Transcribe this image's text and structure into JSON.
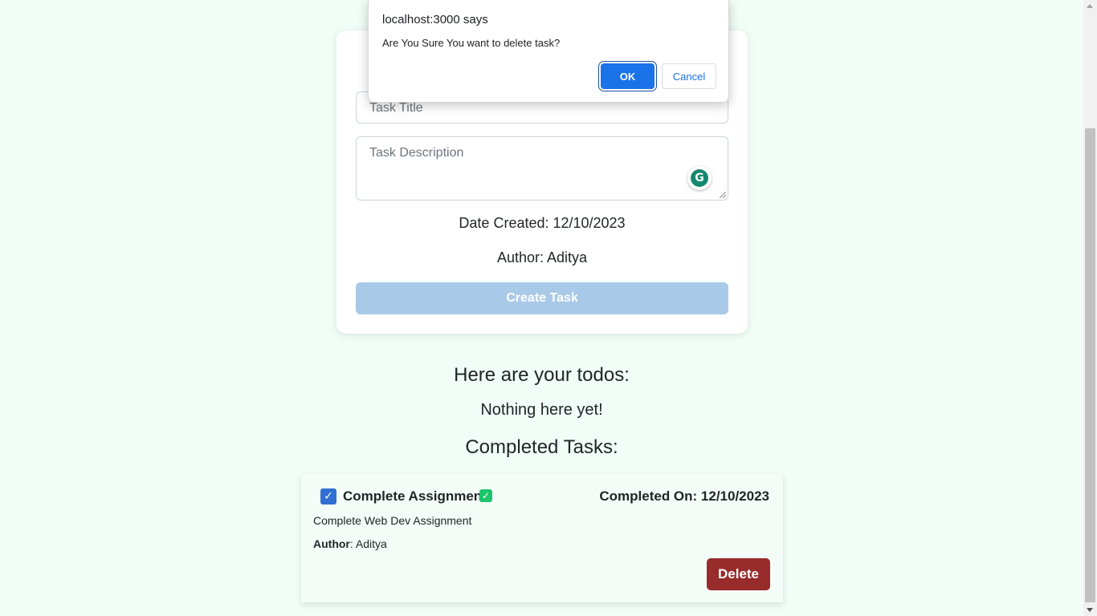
{
  "dialog": {
    "origin": "localhost:3000 says",
    "message": "Are You Sure You want to delete task?",
    "ok_label": "OK",
    "cancel_label": "Cancel"
  },
  "form": {
    "title_placeholder": "Task Title",
    "description_placeholder": "Task Description",
    "date_created": "Date Created: 12/10/2023",
    "author": "Author: Aditya",
    "create_label": "Create Task",
    "grammarly_icon": "G"
  },
  "todos": {
    "heading": "Here are your todos:",
    "empty_message": "Nothing here yet!"
  },
  "completed": {
    "heading": "Completed Tasks:",
    "tasks": [
      {
        "checked_mark": "✓",
        "title": "Complete Assignment",
        "done_mark": "✓",
        "completed_on": "Completed On: 12/10/2023",
        "description": "Complete Web Dev Assignment",
        "author_label": "Author",
        "author_value": ": Aditya",
        "delete_label": "Delete"
      }
    ]
  },
  "colors": {
    "background": "#f1fdf7",
    "primary": "#1a73e8",
    "create_button_disabled": "#a9c9e8",
    "delete_button": "#982b2b",
    "checkbox": "#2f6fd1",
    "done_icon": "#1ec46b"
  }
}
